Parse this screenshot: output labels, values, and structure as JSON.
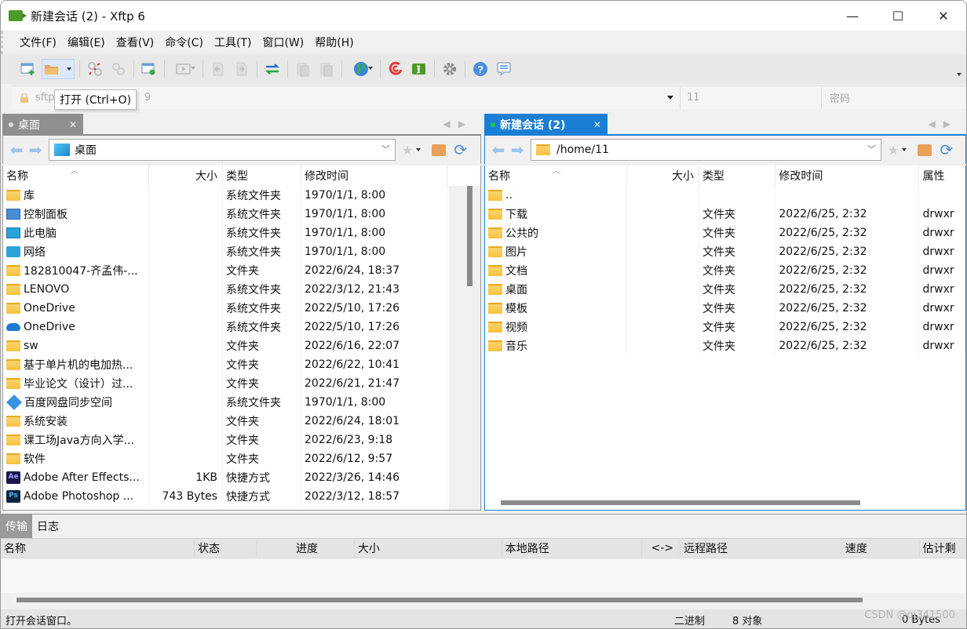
{
  "window": {
    "title": "新建会话 (2)    - Xftp 6",
    "minimize_label": "—",
    "maximize_label": "☐",
    "close_label": "✕"
  },
  "menu": [
    "文件(F)",
    "编辑(E)",
    "查看(V)",
    "命令(C)",
    "工具(T)",
    "窗口(W)",
    "帮助(H)"
  ],
  "toolbar": {
    "buttons": [
      "new-session",
      "open",
      "disconnect",
      "reconnect",
      "session-properties",
      "transfer",
      "upload",
      "download",
      "sync",
      "copy",
      "paste",
      "world",
      "xshell",
      "xftp",
      "settings",
      "help",
      "chat"
    ],
    "tooltip": "打开 (Ctrl+O)"
  },
  "address": {
    "host_prefix": "sftp:",
    "host_suffix": "9",
    "username": "11",
    "password_placeholder": "密码"
  },
  "local": {
    "tab_label": "桌面",
    "path": "桌面",
    "columns": [
      "名称",
      "大小",
      "类型",
      "修改时间"
    ],
    "rows": [
      {
        "icon": "folder",
        "name": "库",
        "size": "",
        "type": "系统文件夹",
        "modified": "1970/1/1, 8:00"
      },
      {
        "icon": "ctrl",
        "name": "控制面板",
        "size": "",
        "type": "系统文件夹",
        "modified": "1970/1/1, 8:00"
      },
      {
        "icon": "pc",
        "name": "此电脑",
        "size": "",
        "type": "系统文件夹",
        "modified": "1970/1/1, 8:00"
      },
      {
        "icon": "net",
        "name": "网络",
        "size": "",
        "type": "系统文件夹",
        "modified": "1970/1/1, 8:00"
      },
      {
        "icon": "folder",
        "name": "182810047-齐孟伟-...",
        "size": "",
        "type": "文件夹",
        "modified": "2022/6/24, 18:37"
      },
      {
        "icon": "folder",
        "name": "LENOVO",
        "size": "",
        "type": "系统文件夹",
        "modified": "2022/3/12, 21:43"
      },
      {
        "icon": "folder",
        "name": "OneDrive",
        "size": "",
        "type": "系统文件夹",
        "modified": "2022/5/10, 17:26"
      },
      {
        "icon": "onedrive",
        "name": "OneDrive",
        "size": "",
        "type": "系统文件夹",
        "modified": "2022/5/10, 17:26"
      },
      {
        "icon": "folder",
        "name": "sw",
        "size": "",
        "type": "文件夹",
        "modified": "2022/6/16, 22:07"
      },
      {
        "icon": "folder",
        "name": "基于单片机的电加热...",
        "size": "",
        "type": "文件夹",
        "modified": "2022/6/22, 10:41"
      },
      {
        "icon": "folder",
        "name": "毕业论文（设计）过...",
        "size": "",
        "type": "文件夹",
        "modified": "2022/6/21, 21:47"
      },
      {
        "icon": "baidu",
        "name": "百度网盘同步空间",
        "size": "",
        "type": "系统文件夹",
        "modified": "1970/1/1, 8:00"
      },
      {
        "icon": "folder",
        "name": "系统安装",
        "size": "",
        "type": "文件夹",
        "modified": "2022/6/24, 18:01"
      },
      {
        "icon": "folder",
        "name": "课工场Java方向入学...",
        "size": "",
        "type": "文件夹",
        "modified": "2022/6/23, 9:18"
      },
      {
        "icon": "folder",
        "name": "软件",
        "size": "",
        "type": "文件夹",
        "modified": "2022/6/12, 9:57"
      },
      {
        "icon": "ae",
        "name": "Adobe After Effects...",
        "size": "1KB",
        "type": "快捷方式",
        "modified": "2022/3/26, 14:46"
      },
      {
        "icon": "ps",
        "name": "Adobe Photoshop ...",
        "size": "743 Bytes",
        "type": "快捷方式",
        "modified": "2022/3/12, 18:57"
      }
    ]
  },
  "remote": {
    "tab_label": "新建会话 (2)",
    "path": "/home/11",
    "columns": [
      "名称",
      "大小",
      "类型",
      "修改时间",
      "属性"
    ],
    "rows": [
      {
        "name": "..",
        "size": "",
        "type": "",
        "modified": "",
        "attr": ""
      },
      {
        "name": "下载",
        "size": "",
        "type": "文件夹",
        "modified": "2022/6/25, 2:32",
        "attr": "drwxr"
      },
      {
        "name": "公共的",
        "size": "",
        "type": "文件夹",
        "modified": "2022/6/25, 2:32",
        "attr": "drwxr"
      },
      {
        "name": "图片",
        "size": "",
        "type": "文件夹",
        "modified": "2022/6/25, 2:32",
        "attr": "drwxr"
      },
      {
        "name": "文档",
        "size": "",
        "type": "文件夹",
        "modified": "2022/6/25, 2:32",
        "attr": "drwxr"
      },
      {
        "name": "桌面",
        "size": "",
        "type": "文件夹",
        "modified": "2022/6/25, 2:32",
        "attr": "drwxr"
      },
      {
        "name": "模板",
        "size": "",
        "type": "文件夹",
        "modified": "2022/6/25, 2:32",
        "attr": "drwxr"
      },
      {
        "name": "视频",
        "size": "",
        "type": "文件夹",
        "modified": "2022/6/25, 2:32",
        "attr": "drwxr"
      },
      {
        "name": "音乐",
        "size": "",
        "type": "文件夹",
        "modified": "2022/6/25, 2:32",
        "attr": "drwxr"
      }
    ]
  },
  "transfer": {
    "tabs": [
      "传输",
      "日志"
    ],
    "columns": [
      "名称",
      "状态",
      "进度",
      "大小",
      "本地路径",
      "<->",
      "远程路径",
      "速度",
      "估计剩"
    ]
  },
  "status": {
    "message": "打开会话窗口。",
    "mode": "二进制",
    "objects": "8 对象",
    "size": "0 Bytes",
    "watermark": "CSDN @qj341500"
  },
  "colors": {
    "accent": "#1a7fd4",
    "inactive_tab": "#8f8f8f",
    "connected_dot": "#1fc83a"
  }
}
